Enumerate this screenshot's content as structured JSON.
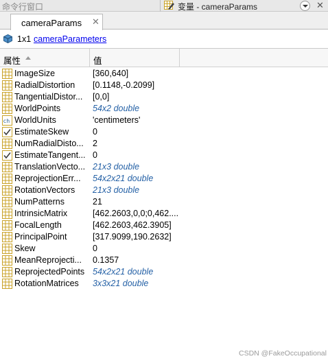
{
  "topbar": {
    "left_title": "命令行窗口",
    "editor_title": "变量 - cameraParams"
  },
  "tab": {
    "label": "cameraParams"
  },
  "info": {
    "dims": "1x1",
    "class_link": "cameraParameters"
  },
  "table": {
    "headers": [
      "属性",
      "值"
    ],
    "rows": [
      {
        "name": "ImageSize",
        "value": "[360,640]",
        "icon": "matrix-icon",
        "italic": false
      },
      {
        "name": "RadialDistortion",
        "value": "[0.1148,-0.2099]",
        "icon": "matrix-icon",
        "italic": false
      },
      {
        "name": "TangentialDistor...",
        "value": "[0,0]",
        "icon": "matrix-icon",
        "italic": false
      },
      {
        "name": "WorldPoints",
        "value": "54x2 double",
        "icon": "matrix-icon",
        "italic": true
      },
      {
        "name": "WorldUnits",
        "value": "'centimeters'",
        "icon": "char-icon",
        "italic": false
      },
      {
        "name": "EstimateSkew",
        "value": "0",
        "icon": "logical-icon",
        "italic": false
      },
      {
        "name": "NumRadialDisto...",
        "value": "2",
        "icon": "matrix-icon",
        "italic": false
      },
      {
        "name": "EstimateTangent...",
        "value": "0",
        "icon": "logical-icon",
        "italic": false
      },
      {
        "name": "TranslationVecto...",
        "value": "21x3 double",
        "icon": "matrix-icon",
        "italic": true
      },
      {
        "name": "ReprojectionErr...",
        "value": "54x2x21 double",
        "icon": "matrix-icon",
        "italic": true
      },
      {
        "name": "RotationVectors",
        "value": "21x3 double",
        "icon": "matrix-icon",
        "italic": true
      },
      {
        "name": "NumPatterns",
        "value": "21",
        "icon": "matrix-icon",
        "italic": false
      },
      {
        "name": "IntrinsicMatrix",
        "value": "[462.2603,0,0;0,462....",
        "icon": "matrix-icon",
        "italic": false
      },
      {
        "name": "FocalLength",
        "value": "[462.2603,462.3905]",
        "icon": "matrix-icon",
        "italic": false
      },
      {
        "name": "PrincipalPoint",
        "value": "[317.9099,190.2632]",
        "icon": "matrix-icon",
        "italic": false
      },
      {
        "name": "Skew",
        "value": "0",
        "icon": "matrix-icon",
        "italic": false
      },
      {
        "name": "MeanReprojecti...",
        "value": "0.1357",
        "icon": "matrix-icon",
        "italic": false
      },
      {
        "name": "ReprojectedPoints",
        "value": "54x2x21 double",
        "icon": "matrix-icon",
        "italic": true
      },
      {
        "name": "RotationMatrices",
        "value": "3x3x21 double",
        "icon": "matrix-icon",
        "italic": true
      }
    ]
  },
  "watermark": "CSDN @FakeOccupational",
  "colors": {
    "link": "#0000ee",
    "italic_value": "#2561a6",
    "matrix_icon_border": "#c9a227"
  }
}
